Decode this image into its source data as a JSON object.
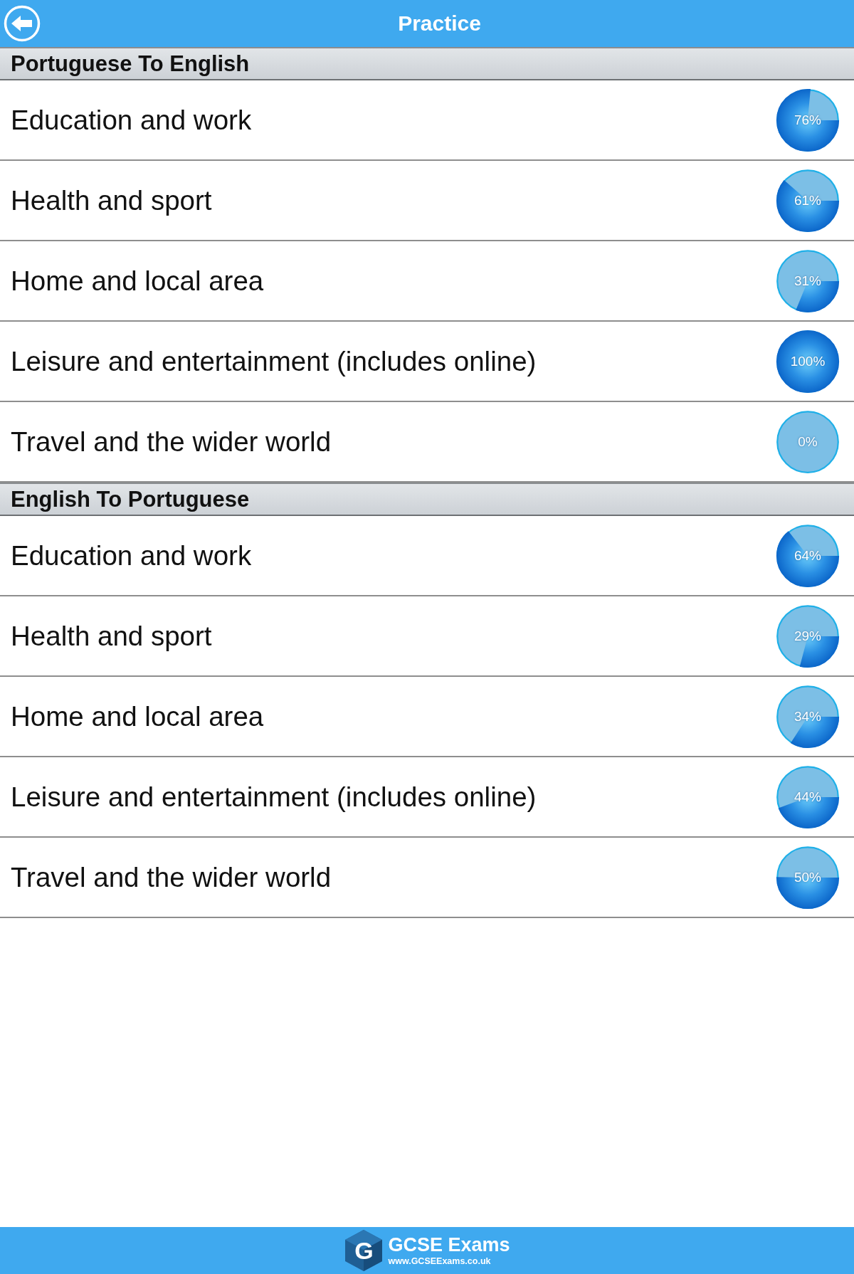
{
  "header": {
    "title": "Practice"
  },
  "sections": [
    {
      "title": "Portuguese To English",
      "topics": [
        {
          "label": "Education and work",
          "level": 0.76,
          "reading": "76%"
        },
        {
          "label": "Health and sport",
          "level": 0.61,
          "reading": "61%"
        },
        {
          "label": "Home and local area",
          "level": 0.31,
          "reading": "31%"
        },
        {
          "label": "Leisure and entertainment (includes online)",
          "level": 1,
          "reading": "100%"
        },
        {
          "label": "Travel and the wider world",
          "level": 0,
          "reading": "0%"
        }
      ]
    },
    {
      "title": "English To Portuguese",
      "topics": [
        {
          "label": "Education and work",
          "level": 0.64,
          "reading": "64%"
        },
        {
          "label": "Health and sport",
          "level": 0.29,
          "reading": "29%"
        },
        {
          "label": "Home and local area",
          "level": 0.34,
          "reading": "34%"
        },
        {
          "label": "Leisure and entertainment (includes online)",
          "level": 0.44,
          "reading": "44%"
        },
        {
          "label": "Travel and the wider world",
          "level": 0.5,
          "reading": "50%"
        }
      ]
    }
  ],
  "footer": {
    "logo_letter": "G",
    "brand": "GCSE Exams",
    "url": "www.GCSEExams.co.uk"
  }
}
